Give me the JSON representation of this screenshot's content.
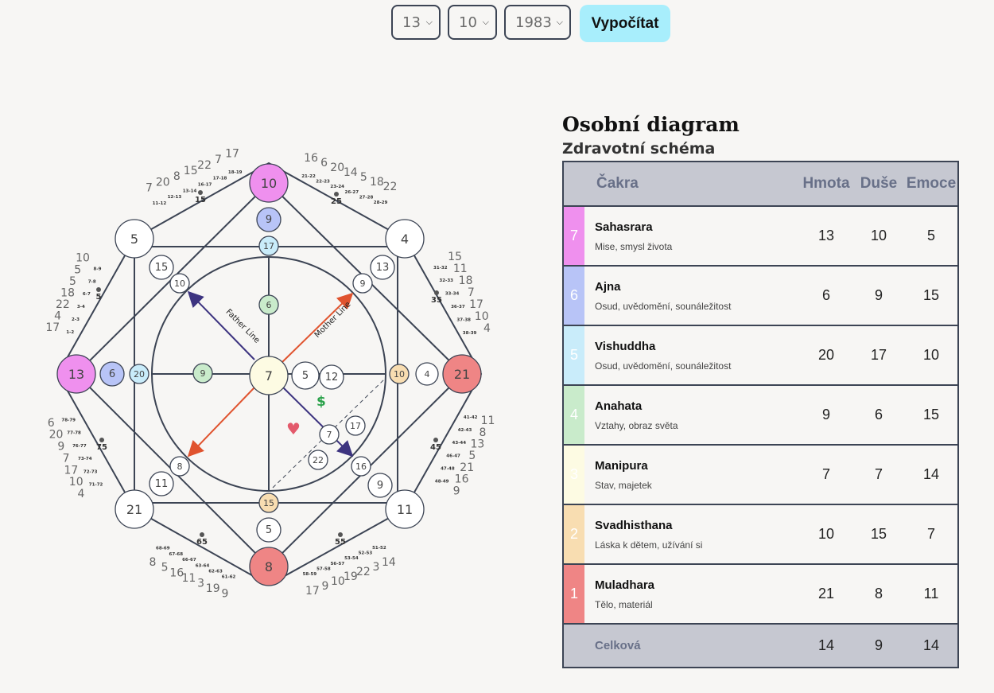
{
  "form": {
    "day": "13",
    "month": "10",
    "year": "1983",
    "submit_label": "Vypočítat"
  },
  "diagram": {
    "outer": {
      "top": "10",
      "top_right": "4",
      "right": "21",
      "bottom_right": "11",
      "bottom": "8",
      "bottom_left": "21",
      "left": "13",
      "top_left": "5"
    },
    "inner": {
      "top_a": "9",
      "top_b": "17",
      "left_a": "6",
      "left_b": "20",
      "right_a": "10",
      "right_b": "4",
      "bottom_a": "15",
      "bottom_b": "5"
    },
    "corners": {
      "tl_a": "15",
      "tl_b": "10",
      "tr_a": "13",
      "tr_b": "9",
      "bl_a": "8",
      "bl_b": "11",
      "br_a": "16",
      "br_b": "9"
    },
    "center": "7",
    "center_right": [
      "5",
      "12"
    ],
    "axis_up": "6",
    "axis_left": "9",
    "lower_right": [
      "7",
      "17",
      "22"
    ],
    "father_line": "Father Line",
    "mother_line": "Mother Line",
    "dollar": "$",
    "heart": "♥",
    "age_bold": [
      "15",
      "25",
      "35",
      "45",
      "55",
      "65",
      "75",
      "5"
    ],
    "edge_top_left": [
      "7",
      "20",
      "8",
      "15",
      "22",
      "7",
      "17"
    ],
    "edge_top_right": [
      "16",
      "6",
      "20",
      "14",
      "5",
      "18",
      "22"
    ],
    "edge_right_upper": [
      "15",
      "11",
      "18",
      "7",
      "17",
      "10",
      "4"
    ],
    "edge_right_lower": [
      "11",
      "8",
      "13",
      "5",
      "21",
      "16",
      "9"
    ],
    "edge_bottom_right": [
      "14",
      "3",
      "22",
      "19",
      "10",
      "9",
      "17"
    ],
    "edge_bottom_left": [
      "9",
      "19",
      "3",
      "11",
      "16",
      "5",
      "8"
    ],
    "edge_left_lower": [
      "4",
      "10",
      "17",
      "7",
      "9",
      "20",
      "6"
    ],
    "edge_left_upper": [
      "17",
      "4",
      "22",
      "18",
      "5",
      "5",
      "10"
    ],
    "age_ranges_top_left": [
      "11-12",
      "12-13",
      "13-14",
      "16-17",
      "17-18",
      "18-19"
    ],
    "age_ranges_top_right": [
      "21-22",
      "22-23",
      "23-24",
      "26-27",
      "27-28",
      "28-29"
    ],
    "age_ranges_right_upper": [
      "31-32",
      "32-33",
      "33-34",
      "36-37",
      "37-38",
      "38-39"
    ],
    "age_ranges_right_lower": [
      "41-42",
      "42-43",
      "43-44",
      "46-47",
      "47-48",
      "48-49"
    ],
    "age_ranges_bottom_right": [
      "51-52",
      "52-53",
      "53-54",
      "56-57",
      "57-58",
      "58-59"
    ],
    "age_ranges_bottom_left": [
      "61-62",
      "62-63",
      "63-64",
      "66-67",
      "67-68",
      "68-69"
    ],
    "age_ranges_left_lower": [
      "71-72",
      "72-73",
      "73-74",
      "76-77",
      "77-78",
      "78-79"
    ],
    "age_ranges_left_upper": [
      "1-2",
      "2-3",
      "3-4",
      "6-7",
      "7-8",
      "8-9"
    ]
  },
  "panel": {
    "title": "Osobní diagram",
    "subtitle": "Zdravotní schéma"
  },
  "table": {
    "headers": {
      "chakra": "Čakra",
      "hmota": "Hmota",
      "duse": "Duše",
      "emoce": "Emoce"
    },
    "rows": [
      {
        "num": "7",
        "color": "#ef90ee",
        "name": "Sahasrara",
        "desc": "Mise, smysl života",
        "hmota": "13",
        "duse": "10",
        "emoce": "5"
      },
      {
        "num": "6",
        "color": "#b8c4f7",
        "name": "Ajna",
        "desc": "Osud, uvědomění, sounáležitost",
        "hmota": "6",
        "duse": "9",
        "emoce": "15"
      },
      {
        "num": "5",
        "color": "#c9ecfa",
        "name": "Vishuddha",
        "desc": "Osud, uvědomění, sounáležitost",
        "hmota": "20",
        "duse": "17",
        "emoce": "10"
      },
      {
        "num": "4",
        "color": "#c9ebcb",
        "name": "Anahata",
        "desc": "Vztahy, obraz světa",
        "hmota": "9",
        "duse": "6",
        "emoce": "15"
      },
      {
        "num": "3",
        "color": "#fdfbe3",
        "name": "Manipura",
        "desc": "Stav, majetek",
        "hmota": "7",
        "duse": "7",
        "emoce": "14"
      },
      {
        "num": "2",
        "color": "#f8ddb1",
        "name": "Svadhisthana",
        "desc": "Láska k dětem, užívání si",
        "hmota": "10",
        "duse": "15",
        "emoce": "7"
      },
      {
        "num": "1",
        "color": "#ef8585",
        "name": "Muladhara",
        "desc": "Tělo, materiál",
        "hmota": "21",
        "duse": "8",
        "emoce": "11"
      }
    ],
    "total": {
      "label": "Celková",
      "hmota": "14",
      "duse": "9",
      "emoce": "14"
    }
  }
}
